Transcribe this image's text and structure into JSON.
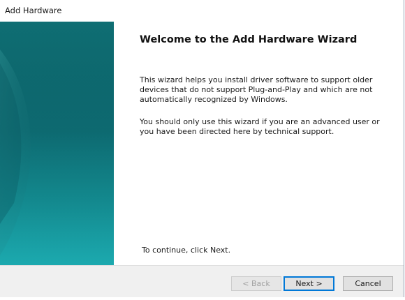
{
  "window": {
    "title": "Add Hardware"
  },
  "wizard": {
    "heading": "Welcome to the Add Hardware Wizard",
    "paragraph1": "This wizard helps you install driver software to support older devices that do not support Plug-and-Play and which are not automatically recognized by Windows.",
    "paragraph2": "You should only use this wizard if you are an advanced user or you have been directed here by technical support.",
    "continue_text": "To continue, click Next."
  },
  "buttons": {
    "back_label": "< Back",
    "next_label": "Next >",
    "cancel_label": "Cancel"
  },
  "colors": {
    "panel_dark": "#0b6269",
    "panel_light": "#18a0a6",
    "default_button_border": "#0078d7"
  }
}
